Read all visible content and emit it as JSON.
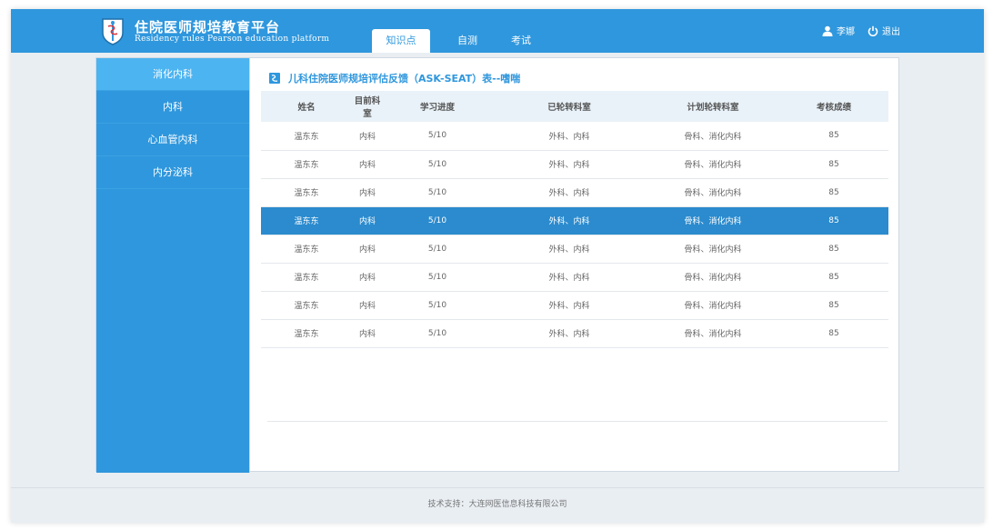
{
  "header": {
    "title": "住院医师规培教育平台",
    "subtitle": "Residency rules Pearson education platform",
    "tabs": [
      {
        "label": "知识点",
        "active": true
      },
      {
        "label": "自测",
        "active": false
      },
      {
        "label": "考试",
        "active": false
      }
    ],
    "user_name": "李娜",
    "logout_label": "退出",
    "accent_color": "#2f97dd"
  },
  "sidebar": {
    "items": [
      {
        "label": "消化内科",
        "active": true
      },
      {
        "label": "内科",
        "active": false
      },
      {
        "label": "心血管内科",
        "active": false
      },
      {
        "label": "内分泌科",
        "active": false
      }
    ]
  },
  "main": {
    "title": "儿科住院医师规培评估反馈（ASK-SEAT）表--嗜喘",
    "columns": [
      "姓名",
      "目前科室",
      "学习进度",
      "已轮转科室",
      "计划轮转科室",
      "考核成绩"
    ],
    "rows": [
      [
        "温东东",
        "内科",
        "5/10",
        "外科、内科",
        "骨科、消化内科",
        "85"
      ],
      [
        "温东东",
        "内科",
        "5/10",
        "外科、内科",
        "骨科、消化内科",
        "85"
      ],
      [
        "温东东",
        "内科",
        "5/10",
        "外科、内科",
        "骨科、消化内科",
        "85"
      ],
      [
        "温东东",
        "内科",
        "5/10",
        "外科、内科",
        "骨科、消化内科",
        "85"
      ],
      [
        "温东东",
        "内科",
        "5/10",
        "外科、内科",
        "骨科、消化内科",
        "85"
      ],
      [
        "温东东",
        "内科",
        "5/10",
        "外科、内科",
        "骨科、消化内科",
        "85"
      ],
      [
        "温东东",
        "内科",
        "5/10",
        "外科、内科",
        "骨科、消化内科",
        "85"
      ],
      [
        "温东东",
        "内科",
        "5/10",
        "外科、内科",
        "骨科、消化内科",
        "85"
      ]
    ],
    "selected_row": 3
  },
  "footer": {
    "text": "技术支持：大连网医信息科技有限公司"
  },
  "icons": {
    "user": "user-icon",
    "logout": "power-icon",
    "title": "document-icon",
    "logo": "caduceus-shield-icon"
  }
}
